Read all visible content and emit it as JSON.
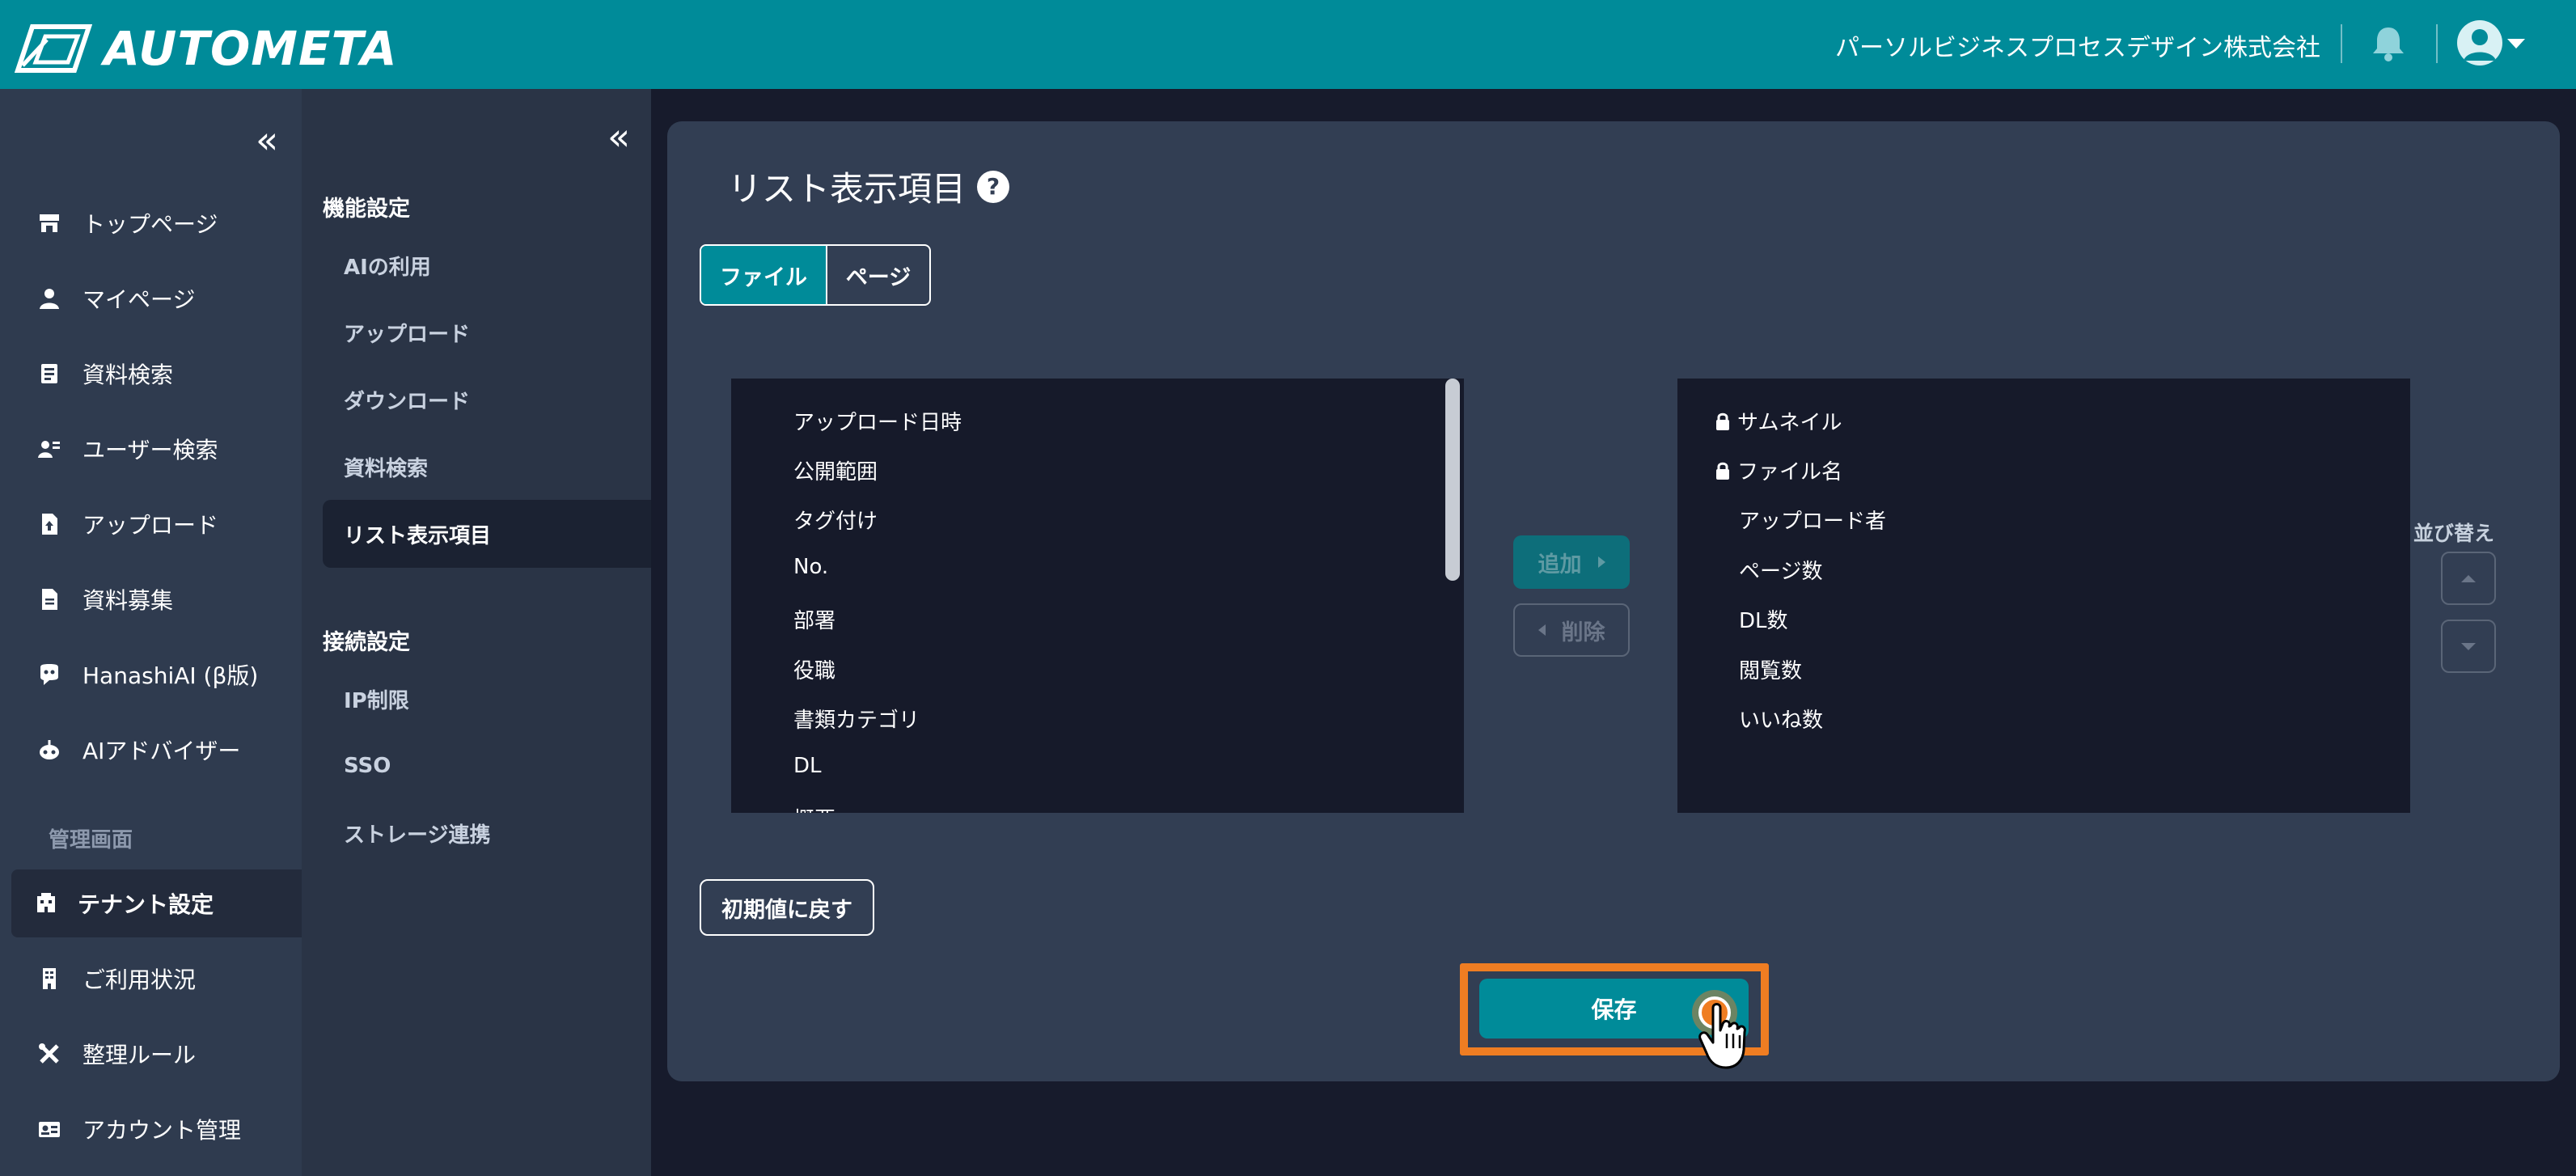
{
  "header": {
    "logo_text": "AUTOMETA",
    "company_name": "パーソルビジネスプロセスデザイン株式会社",
    "bell_icon": "bell-icon",
    "avatar_icon": "user-avatar-icon"
  },
  "sidebar": {
    "items": [
      {
        "label": "トップページ",
        "icon": "store-icon"
      },
      {
        "label": "マイページ",
        "icon": "person-icon"
      },
      {
        "label": "資料検索",
        "icon": "document-search-icon"
      },
      {
        "label": "ユーザー検索",
        "icon": "user-search-icon"
      },
      {
        "label": "アップロード",
        "icon": "file-upload-icon"
      },
      {
        "label": "資料募集",
        "icon": "file-icon"
      },
      {
        "label": "HanashiAI (β版)",
        "icon": "chat-bot-icon"
      },
      {
        "label": "AIアドバイザー",
        "icon": "robot-icon"
      }
    ],
    "admin_section_label": "管理画面",
    "admin_items": [
      {
        "label": "テナント設定",
        "icon": "building-icon"
      },
      {
        "label": "ご利用状況",
        "icon": "office-icon"
      },
      {
        "label": "整理ルール",
        "icon": "tools-icon"
      },
      {
        "label": "アカウント管理",
        "icon": "id-card-icon"
      }
    ]
  },
  "subnav": {
    "function_heading": "機能設定",
    "function_items": [
      "AIの利用",
      "アップロード",
      "ダウンロード",
      "資料検索",
      "リスト表示項目"
    ],
    "connection_heading": "接続設定",
    "connection_items": [
      "IP制限",
      "SSO",
      "ストレージ連携"
    ]
  },
  "main": {
    "title": "リスト表示項目",
    "help_glyph": "?",
    "tabs": [
      "ファイル",
      "ページ"
    ],
    "available_items": [
      "アップロード日時",
      "公開範囲",
      "タグ付け",
      "No.",
      "部署",
      "役職",
      "書類カテゴリ",
      "DL",
      "概要"
    ],
    "selected_items": [
      {
        "label": "サムネイル",
        "locked": true
      },
      {
        "label": "ファイル名",
        "locked": true
      },
      {
        "label": "アップロード者",
        "locked": false
      },
      {
        "label": "ページ数",
        "locked": false
      },
      {
        "label": "DL数",
        "locked": false
      },
      {
        "label": "閲覧数",
        "locked": false
      },
      {
        "label": "いいね数",
        "locked": false
      }
    ],
    "add_label": "追加",
    "remove_label": "削除",
    "sort_label": "並び替え",
    "reset_label": "初期値に戻す",
    "save_label": "保存"
  },
  "colors": {
    "accent": "#008b99",
    "highlight": "#ef7d22",
    "background": "#171b2c"
  }
}
